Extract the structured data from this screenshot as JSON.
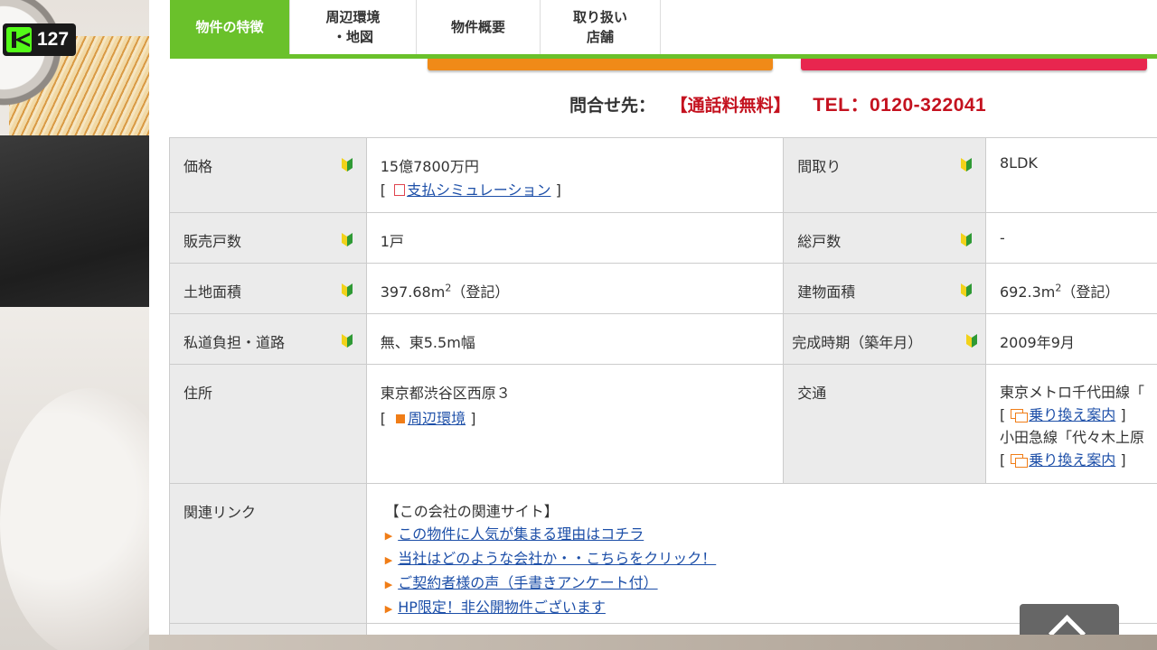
{
  "overlay": {
    "viewer_count": "127"
  },
  "tabs": [
    {
      "line1": "物件の特徴",
      "line2": ""
    },
    {
      "line1": "周辺環境",
      "line2": "・地図"
    },
    {
      "line1": "物件概要",
      "line2": ""
    },
    {
      "line1": "取り扱い",
      "line2": "店舗"
    }
  ],
  "contact": {
    "label": "問合せ先：",
    "free": "【通話料無料】",
    "tel": "TEL：0120-322041"
  },
  "spec": {
    "price_label": "価格",
    "price_value": "15億7800万円",
    "payment_link": "支払シミュレーション",
    "layout_label": "間取り",
    "layout_value": "8LDK",
    "units_sold_label": "販売戸数",
    "units_sold_value": "1戸",
    "total_units_label": "総戸数",
    "total_units_value": "-",
    "land_area_label": "土地面積",
    "land_area_value": "397.68m",
    "land_area_note": "（登記）",
    "building_area_label": "建物面積",
    "building_area_value": "692.3m",
    "building_area_note": "（登記）",
    "sup2": "2",
    "private_road_label": "私道負担・道路",
    "private_road_value": "無、東5.5m幅",
    "completion_label": "完成時期（築年月）",
    "completion_value": "2009年9月",
    "address_label": "住所",
    "address_value": "東京都渋谷区西原３",
    "area_link": "周辺環境",
    "transport_label": "交通",
    "transport_line1": "東京メトロ千代田線「",
    "transport_line2": "小田急線「代々木上原",
    "transfer_link": "乗り換え案内",
    "related_label": "関連リンク",
    "related_heading": "【この会社の関連サイト】",
    "related_links": [
      "この物件に人気が集まる理由はコチラ",
      "当社はどのような会社か・・こちらをクリック！",
      "ご契約者様の声（手書きアンケート付）",
      "HP限定！非公開物件ございます"
    ]
  },
  "colors": {
    "tab_green": "#6ac12b",
    "tel_red": "#c4121f",
    "link_blue": "#1d4fa8"
  }
}
